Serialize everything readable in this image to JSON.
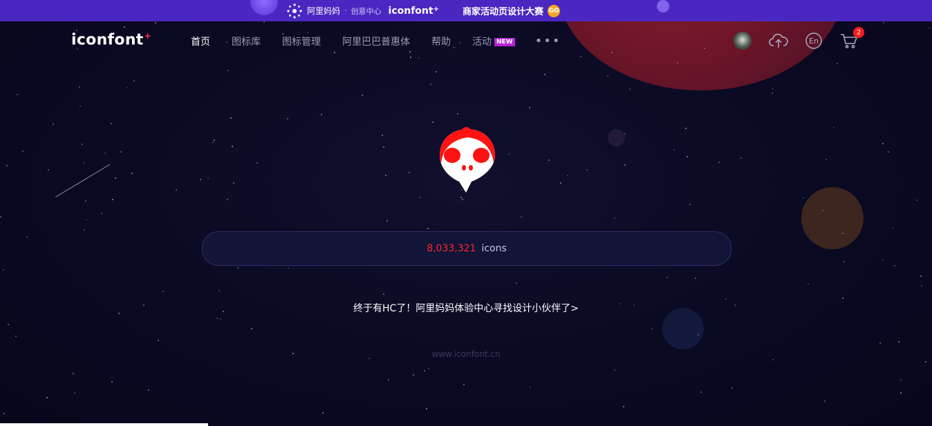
{
  "promo": {
    "alimama": "阿里妈妈",
    "separator": "·",
    "subtitle": "创意中心",
    "brand": "iconfont",
    "brand_plus": "+",
    "title": "商家活动页设计大赛",
    "go": "GO"
  },
  "header": {
    "logo": "iconfont",
    "logo_plus": "+",
    "nav": [
      {
        "label": "首页"
      },
      {
        "label": "图标库"
      },
      {
        "label": "图标管理"
      },
      {
        "label": "阿里巴巴普惠体"
      },
      {
        "label": "帮助"
      },
      {
        "label": "活动"
      }
    ],
    "new_badge": "NEW",
    "more": "•••",
    "cart_count": "2"
  },
  "hero": {
    "icon_count": "8,033,321",
    "icon_unit": "icons",
    "announcement": "终于有HC了！阿里妈妈体验中心寻找设计小伙伴了>",
    "site_url": "www.iconfont.cn"
  },
  "colors": {
    "background": "#0b0a24",
    "promo_bar": "#4a27c0",
    "accent_red": "#ff2a2a",
    "new_badge": "#b623d6"
  },
  "icons": [
    "avatar",
    "upload-cloud-icon",
    "language-en-icon",
    "cart-icon",
    "skull-mascot-icon"
  ]
}
